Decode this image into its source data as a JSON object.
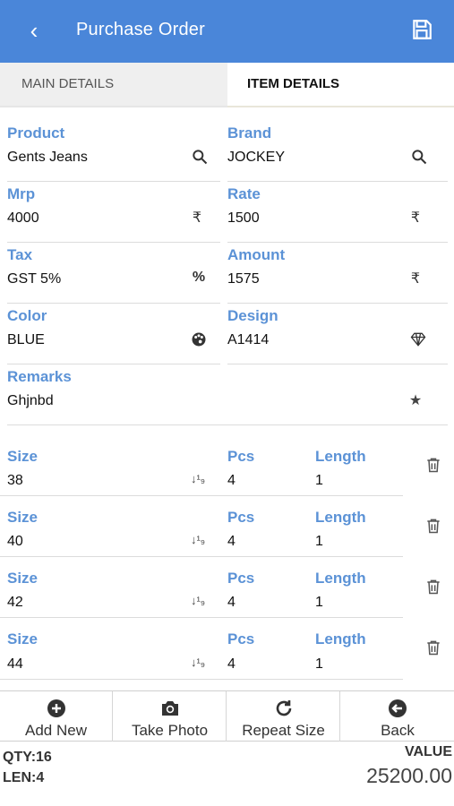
{
  "header": {
    "title": "Purchase Order",
    "back_icon": "chevron-left-icon",
    "save_icon": "save-icon"
  },
  "tabs": [
    {
      "label": "MAIN DETAILS"
    },
    {
      "label": "ITEM DETAILS"
    }
  ],
  "fields": {
    "product": {
      "label": "Product",
      "value": "Gents Jeans",
      "icon": "search-icon"
    },
    "brand": {
      "label": "Brand",
      "value": "JOCKEY",
      "icon": "search-icon"
    },
    "mrp": {
      "label": "Mrp",
      "value": "4000",
      "icon": "rupee-icon",
      "icon_glyph": "₹"
    },
    "rate": {
      "label": "Rate",
      "value": "1500",
      "icon": "rupee-icon",
      "icon_glyph": "₹"
    },
    "tax": {
      "label": "Tax",
      "value": "GST 5%",
      "icon": "percent-icon",
      "icon_glyph": "%"
    },
    "amount": {
      "label": "Amount",
      "value": "1575",
      "icon": "rupee-icon",
      "icon_glyph": "₹"
    },
    "color": {
      "label": "Color",
      "value": "BLUE",
      "icon": "palette-icon"
    },
    "design": {
      "label": "Design",
      "value": "A1414",
      "icon": "diamond-icon"
    },
    "remarks": {
      "label": "Remarks",
      "value": "Ghjnbd",
      "icon": "star-icon",
      "icon_glyph": "★"
    }
  },
  "sizes": [
    {
      "size_label": "Size",
      "size": "38",
      "pcs_label": "Pcs",
      "pcs": "4",
      "length_label": "Length",
      "length": "1"
    },
    {
      "size_label": "Size",
      "size": "40",
      "pcs_label": "Pcs",
      "pcs": "4",
      "length_label": "Length",
      "length": "1"
    },
    {
      "size_label": "Size",
      "size": "42",
      "pcs_label": "Pcs",
      "pcs": "4",
      "length_label": "Length",
      "length": "1"
    },
    {
      "size_label": "Size",
      "size": "44",
      "pcs_label": "Pcs",
      "pcs": "4",
      "length_label": "Length",
      "length": "1"
    }
  ],
  "actions": [
    {
      "label": "Add New",
      "icon": "plus-circle-icon"
    },
    {
      "label": "Take Photo",
      "icon": "camera-icon"
    },
    {
      "label": "Repeat Size",
      "icon": "redo-icon"
    },
    {
      "label": "Back",
      "icon": "arrow-left-circle-icon"
    }
  ],
  "totals": {
    "qty": "QTY:16",
    "len": "LEN:4",
    "value_label": "VALUE",
    "value": "25200.00"
  },
  "colors": {
    "primary": "#4a86d9",
    "label_blue": "#3f7fcf"
  }
}
